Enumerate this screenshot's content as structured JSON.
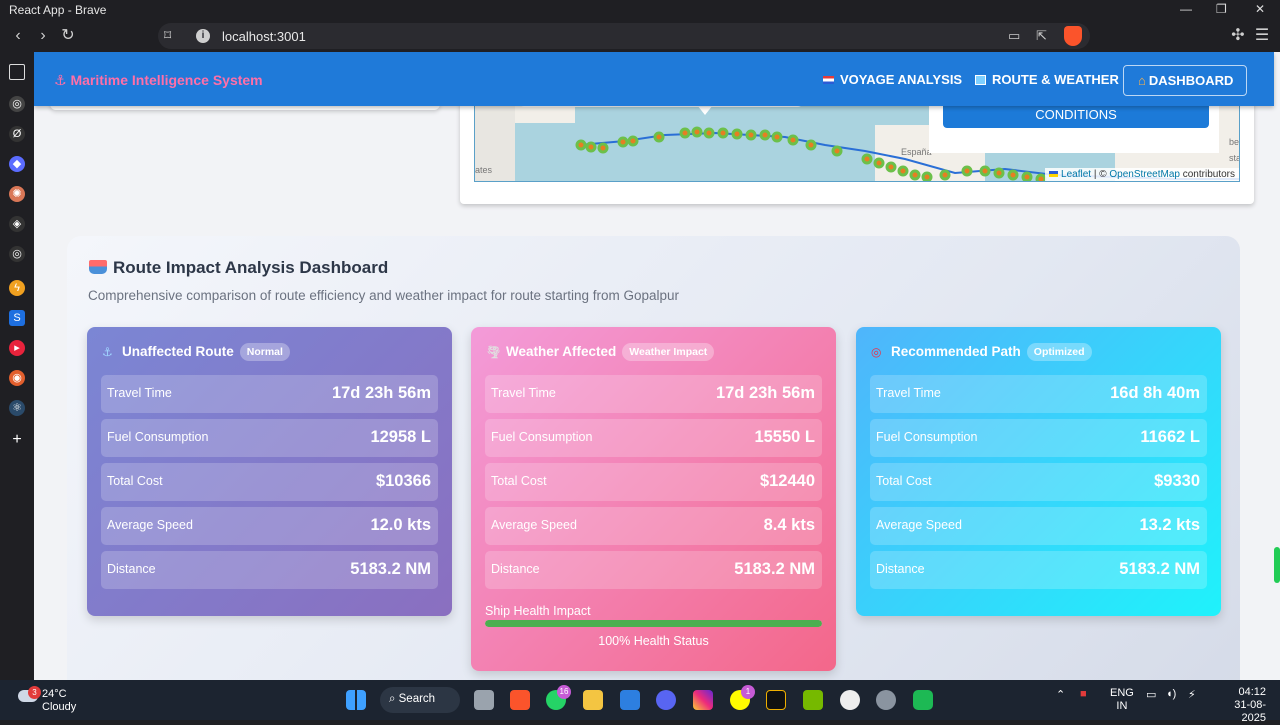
{
  "browser": {
    "window_title": "React App - Brave",
    "url": "localhost:3001"
  },
  "appbar": {
    "brand": "Maritime Intelligence System",
    "nav": [
      {
        "label": "VOYAGE ANALYSIS",
        "icon": "flag-icon"
      },
      {
        "label": "ROUTE & WEATHER",
        "icon": "map-icon"
      },
      {
        "label": "DASHBOARD",
        "icon": "house-icon"
      }
    ]
  },
  "map": {
    "conditions_button": "CONDITIONS",
    "label_espana": "España",
    "label_ates": "ates",
    "label_beki": "beki",
    "label_star": "star",
    "attribution_leaflet": "Leaflet",
    "attribution_sep": "| ©",
    "attribution_osm": "OpenStreetMap",
    "attribution_contrib": "contributors"
  },
  "dashboard": {
    "title": "Route Impact Analysis Dashboard",
    "subtitle": "Comprehensive comparison of route efficiency and weather impact for route starting from Gopalpur",
    "cards": [
      {
        "title": "Unaffected Route",
        "badge": "Normal",
        "icon": "anchor-icon",
        "metrics": [
          {
            "label": "Travel Time",
            "value": "17d 23h 56m"
          },
          {
            "label": "Fuel Consumption",
            "value": "12958 L"
          },
          {
            "label": "Total Cost",
            "value": "$10366"
          },
          {
            "label": "Average Speed",
            "value": "12.0 kts"
          },
          {
            "label": "Distance",
            "value": "5183.2 NM"
          }
        ]
      },
      {
        "title": "Weather Affected",
        "badge": "Weather Impact",
        "icon": "tornado-icon",
        "metrics": [
          {
            "label": "Travel Time",
            "value": "17d 23h 56m"
          },
          {
            "label": "Fuel Consumption",
            "value": "15550 L"
          },
          {
            "label": "Total Cost",
            "value": "$12440"
          },
          {
            "label": "Average Speed",
            "value": "8.4 kts"
          },
          {
            "label": "Distance",
            "value": "5183.2 NM"
          }
        ],
        "health_label": "Ship Health Impact",
        "health_percent": 100,
        "health_status": "100% Health Status"
      },
      {
        "title": "Recommended Path",
        "badge": "Optimized",
        "icon": "target-icon",
        "metrics": [
          {
            "label": "Travel Time",
            "value": "16d 8h 40m"
          },
          {
            "label": "Fuel Consumption",
            "value": "11662 L"
          },
          {
            "label": "Total Cost",
            "value": "$9330"
          },
          {
            "label": "Average Speed",
            "value": "13.2 kts"
          },
          {
            "label": "Distance",
            "value": "5183.2 NM"
          }
        ]
      }
    ]
  },
  "taskbar": {
    "temperature": "24°C",
    "condition": "Cloudy",
    "weather_alert_count": "3",
    "search_label": "Search",
    "whatsapp_badge": "16",
    "snapchat_badge": "1",
    "language_line1": "ENG",
    "language_line2": "IN",
    "time": "04:12",
    "date": "31-08-2025"
  },
  "colors": {
    "appbar": "#1f7ad9",
    "brand": "#ff6fa8",
    "card_unaffected": "#7b86d4",
    "card_weather": "#f3678a",
    "card_recommended": "#1ff2fb",
    "health_bar": "#4caf50"
  }
}
